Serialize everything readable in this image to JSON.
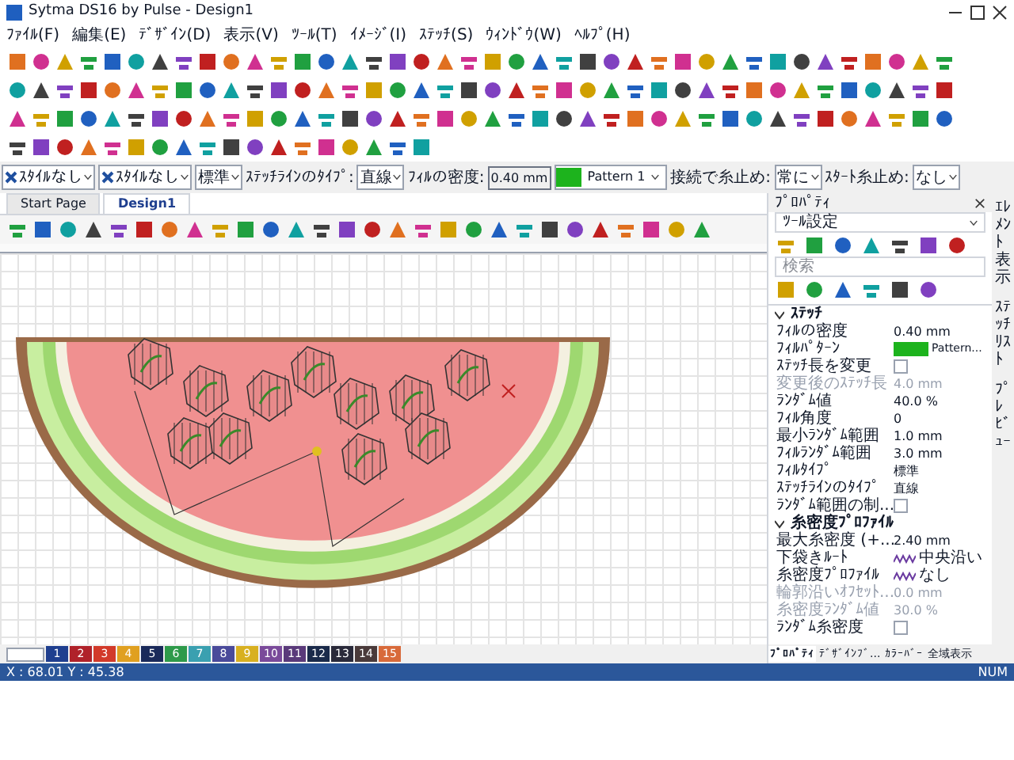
{
  "window": {
    "title": "Sytma DS16 by Pulse - Design1"
  },
  "menu": [
    "ﾌｧｲﾙ(F)",
    "編集(E)",
    "ﾃﾞｻﾞｲﾝ(D)",
    "表示(V)",
    "ﾂｰﾙ(T)",
    "ｲﾒｰｼﾞ(I)",
    "ｽﾃｯﾁ(S)",
    "ｳｨﾝﾄﾞｳ(W)",
    "ﾍﾙﾌﾟ(H)"
  ],
  "style_bar": [
    {
      "kind": "combo",
      "icon": true,
      "value": "ｽﾀｲﾙなし"
    },
    {
      "kind": "combo",
      "icon": true,
      "value": "ｽﾀｲﾙなし"
    },
    {
      "kind": "combo",
      "icon": false,
      "value": "標準"
    },
    {
      "kind": "label",
      "text": "ｽﾃｯﾁﾗｲﾝのﾀｲﾌﾟ:"
    },
    {
      "kind": "combo",
      "icon": false,
      "value": "直線"
    },
    {
      "kind": "label",
      "text": "ﾌｨﾙの密度:"
    },
    {
      "kind": "input",
      "value": "0.40 mm"
    },
    {
      "kind": "pattern",
      "color": "#1db31d",
      "value": "Pattern 1"
    },
    {
      "kind": "label",
      "text": "接続で糸止め:"
    },
    {
      "kind": "combo",
      "icon": false,
      "value": "常に"
    },
    {
      "kind": "label",
      "text": "ｽﾀｰﾄ糸止め:"
    },
    {
      "kind": "combo",
      "icon": false,
      "value": "なし"
    }
  ],
  "document_tabs": [
    {
      "label": "Start Page",
      "selected": false
    },
    {
      "label": "Design1",
      "selected": true
    }
  ],
  "properties": {
    "title": "ﾌﾟﾛﾊﾟﾃｨ",
    "tool_select": "ﾂｰﾙ設定",
    "search": {
      "placeholder": "検索"
    },
    "groups": [
      {
        "title": "ｽﾃｯﾁ",
        "expanded": true,
        "rows": [
          {
            "kind": "text",
            "label": "ﾌｨﾙの密度",
            "value": "0.40 mm",
            "disabled": false
          },
          {
            "kind": "color",
            "label": "ﾌｨﾙﾊﾟﾀｰﾝ",
            "color": "#1db31d",
            "value": "Pattern...",
            "disabled": false
          },
          {
            "kind": "check",
            "label": "ｽﾃｯﾁ長を変更",
            "checked": false,
            "disabled": false
          },
          {
            "kind": "text",
            "label": "変更後のｽﾃｯﾁ長",
            "value": "4.0 mm",
            "disabled": true
          },
          {
            "kind": "text",
            "label": "ﾗﾝﾀﾞﾑ値",
            "value": "40.0 %",
            "disabled": false
          },
          {
            "kind": "text",
            "label": "ﾌｨﾙ角度",
            "value": "0",
            "disabled": false
          },
          {
            "kind": "text",
            "label": "最小ﾗﾝﾀﾞﾑ範囲",
            "value": "1.0 mm",
            "disabled": false
          },
          {
            "kind": "text",
            "label": "ﾌｨﾙﾗﾝﾀﾞﾑ範囲",
            "value": "3.0 mm",
            "disabled": false
          },
          {
            "kind": "text",
            "label": "ﾌｨﾙﾀｲﾌﾟ",
            "value": "標準",
            "disabled": false
          },
          {
            "kind": "text",
            "label": "ｽﾃｯﾁﾗｲﾝのﾀｲﾌﾟ",
            "value": "直線",
            "disabled": false
          },
          {
            "kind": "check",
            "label": "ﾗﾝﾀﾞﾑ範囲の制...",
            "checked": false,
            "disabled": false
          }
        ]
      },
      {
        "title": "糸密度ﾌﾟﾛﾌｧｲﾙ",
        "expanded": true,
        "rows": [
          {
            "kind": "text",
            "label": "最大糸密度 (+...",
            "value": "2.40 mm",
            "disabled": false
          },
          {
            "kind": "profile",
            "label": "下袋きﾙｰﾄ",
            "value": "中央沿い",
            "disabled": false
          },
          {
            "kind": "profile",
            "label": "糸密度ﾌﾟﾛﾌｧｲﾙ",
            "value": "なし",
            "disabled": false
          },
          {
            "kind": "text",
            "label": "輪郭沿いｵﾌｾｯﾄ...",
            "value": "0.0 mm",
            "disabled": true
          },
          {
            "kind": "text",
            "label": "糸密度ﾗﾝﾀﾞﾑ値",
            "value": "30.0 %",
            "disabled": true
          },
          {
            "kind": "check",
            "label": "ﾗﾝﾀﾞﾑ糸密度",
            "checked": false,
            "disabled": false
          }
        ]
      }
    ]
  },
  "panel_tabs": [
    {
      "label": "ﾌﾟﾛﾊﾟﾃｨ",
      "selected": true
    },
    {
      "label": "ﾃﾞｻﾞｲﾝﾌﾞ...",
      "selected": false
    },
    {
      "label": "ｶﾗｰﾊﾞｰ",
      "selected": false
    },
    {
      "label": "全域表示",
      "selected": false
    }
  ],
  "side_tabs": [
    "ｴﾚﾒﾝﾄ表示",
    "ｽﾃｯﾁﾘｽﾄ",
    "ﾌﾟﾚﾋﾞｭｰ"
  ],
  "palette": [
    {
      "label": "1",
      "color": "#1f3f8f"
    },
    {
      "label": "2",
      "color": "#b0222a"
    },
    {
      "label": "3",
      "color": "#d23a2a"
    },
    {
      "label": "4",
      "color": "#e0a020"
    },
    {
      "label": "5",
      "color": "#1a2a5a"
    },
    {
      "label": "6",
      "color": "#2e9a4a"
    },
    {
      "label": "7",
      "color": "#3aa0b0"
    },
    {
      "label": "8",
      "color": "#4a4a9a"
    },
    {
      "label": "9",
      "color": "#d8b020"
    },
    {
      "label": "10",
      "color": "#7a4a9a"
    },
    {
      "label": "11",
      "color": "#5a3a7a"
    },
    {
      "label": "12",
      "color": "#1a2a4a"
    },
    {
      "label": "13",
      "color": "#2a2a3a"
    },
    {
      "label": "14",
      "color": "#4a3a3a"
    },
    {
      "label": "15",
      "color": "#d86a3a"
    }
  ],
  "status_bar": {
    "coords": "X : 68.01 Y : 45.38",
    "num": "NUM"
  }
}
